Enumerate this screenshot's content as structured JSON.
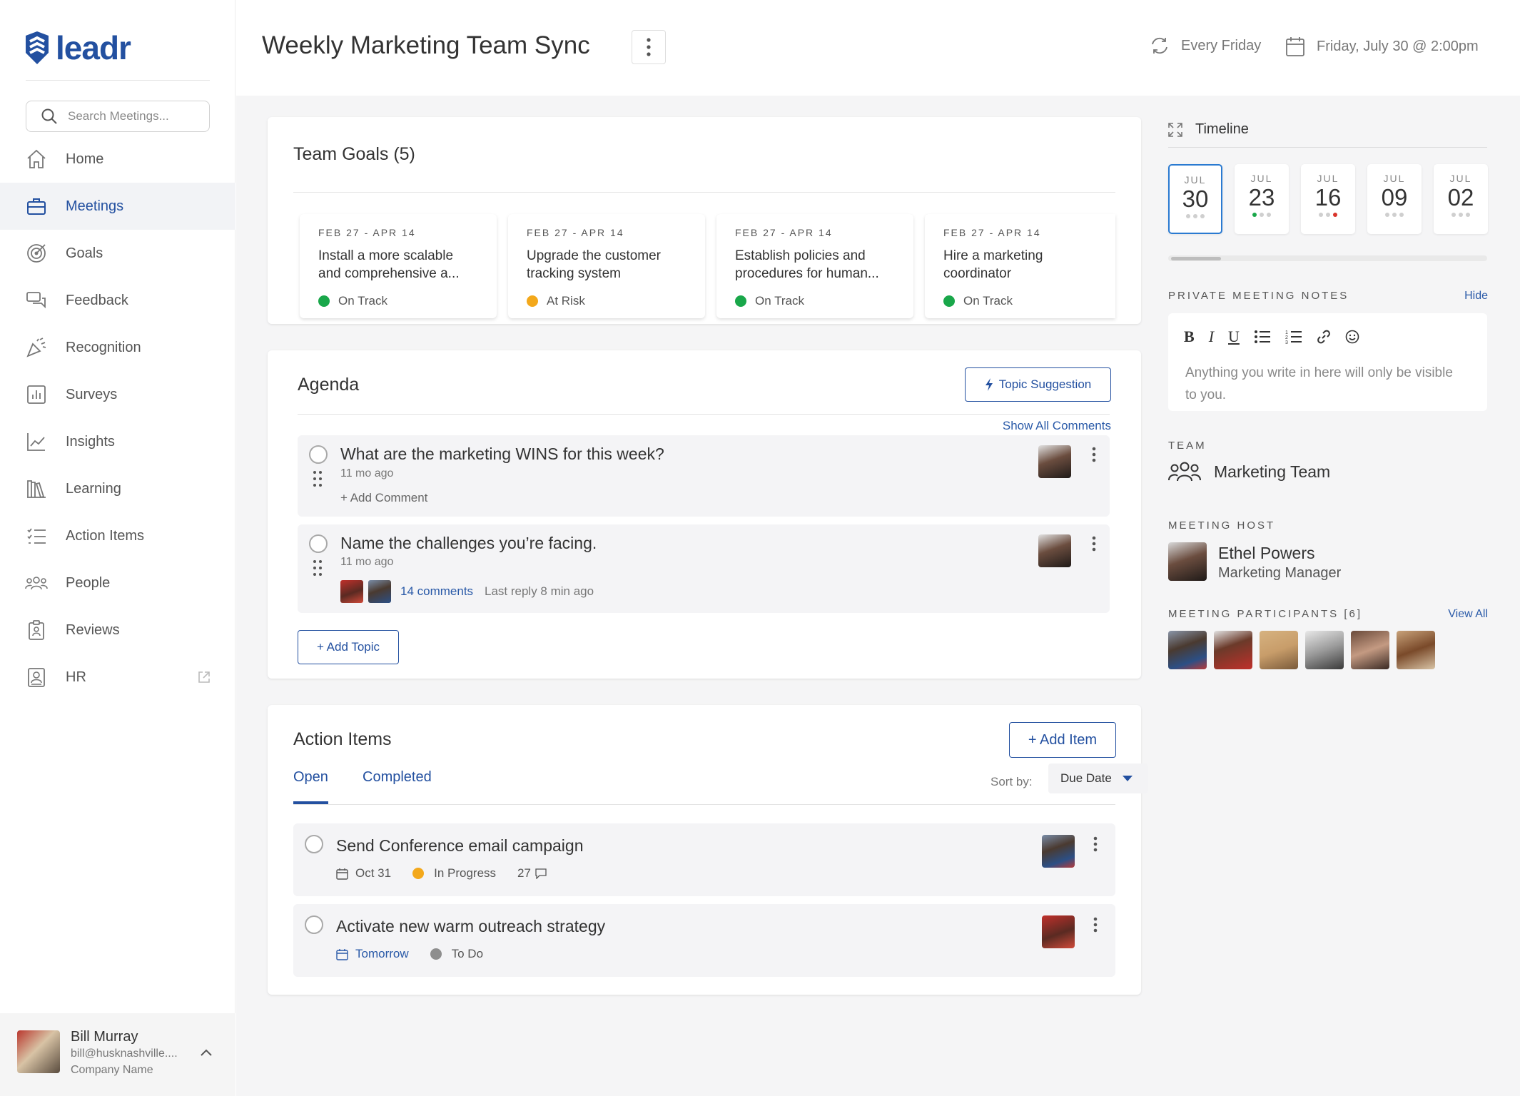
{
  "app": {
    "logo_text": "leadr",
    "brand_color": "#2350a0"
  },
  "sidebar": {
    "search_placeholder": "Search Meetings...",
    "items": [
      {
        "label": "Home",
        "icon": "home-icon"
      },
      {
        "label": "Meetings",
        "icon": "briefcase-icon",
        "active": true
      },
      {
        "label": "Goals",
        "icon": "target-icon"
      },
      {
        "label": "Feedback",
        "icon": "chat-bubbles-icon"
      },
      {
        "label": "Recognition",
        "icon": "party-popper-icon"
      },
      {
        "label": "Surveys",
        "icon": "bar-chart-icon"
      },
      {
        "label": "Insights",
        "icon": "line-chart-icon"
      },
      {
        "label": "Learning",
        "icon": "books-icon"
      },
      {
        "label": "Action Items",
        "icon": "checklist-icon"
      },
      {
        "label": "People",
        "icon": "people-icon"
      },
      {
        "label": "Reviews",
        "icon": "clipboard-icon"
      },
      {
        "label": "HR",
        "icon": "id-badge-icon"
      }
    ],
    "user": {
      "name": "Bill Murray",
      "email": "bill@husknashville....",
      "company": "Company Name"
    }
  },
  "header": {
    "title": "Weekly Marketing Team Sync",
    "recurrence": "Every Friday",
    "datetime": "Friday, July 30 @ 2:00pm"
  },
  "goals": {
    "title": "Team Goals (5)",
    "items": [
      {
        "date": "FEB 27 - APR 14",
        "title": "Install a more scalable and comprehensive a...",
        "status": "On Track",
        "status_color": "#19a74a"
      },
      {
        "date": "FEB 27 - APR 14",
        "title": "Upgrade the customer tracking system",
        "status": "At Risk",
        "status_color": "#f3a81b"
      },
      {
        "date": "FEB 27 - APR 14",
        "title": "Establish policies and procedures for human...",
        "status": "On Track",
        "status_color": "#19a74a"
      },
      {
        "date": "FEB 27 - APR 14",
        "title": "Hire a marketing coordinator",
        "status": "On Track",
        "status_color": "#19a74a"
      }
    ]
  },
  "agenda": {
    "title": "Agenda",
    "topic_suggestion_label": "Topic Suggestion",
    "show_all_comments": "Show All Comments",
    "topics": [
      {
        "title": "What are the marketing WINS for this week?",
        "age": "11 mo ago",
        "add_comment": "+ Add Comment"
      },
      {
        "title": "Name the challenges you’re facing.",
        "age": "11 mo ago",
        "comments": "14 comments",
        "last_reply": "Last reply 8 min ago"
      }
    ],
    "add_topic_label": "+ Add Topic"
  },
  "action_items": {
    "title": "Action Items",
    "add_label": "+ Add Item",
    "tabs": [
      {
        "label": "Open",
        "active": true
      },
      {
        "label": "Completed"
      }
    ],
    "sort_label": "Sort by:",
    "sort_value": "Due Date",
    "items": [
      {
        "title": "Send Conference email campaign",
        "due": "Oct 31",
        "status": "In Progress",
        "status_color": "#f3a81b",
        "comment_count": "27"
      },
      {
        "title": "Activate new warm outreach strategy",
        "due": "Tomorrow",
        "status": "To Do",
        "status_color": "#8e8e8e"
      }
    ]
  },
  "timeline": {
    "title": "Timeline",
    "days": [
      {
        "month": "JUL",
        "day": "30",
        "active": true
      },
      {
        "month": "JUL",
        "day": "23"
      },
      {
        "month": "JUL",
        "day": "16"
      },
      {
        "month": "JUL",
        "day": "09"
      },
      {
        "month": "JUL",
        "day": "02"
      }
    ]
  },
  "notes": {
    "label": "PRIVATE MEETING NOTES",
    "hide_label": "Hide",
    "placeholder": "Anything you write in here will only be visible to you."
  },
  "team": {
    "label": "TEAM",
    "name": "Marketing Team"
  },
  "host": {
    "label": "MEETING HOST",
    "name": "Ethel Powers",
    "title": "Marketing Manager"
  },
  "participants": {
    "label": "MEETING PARTICIPANTS [6]",
    "view_all": "View All"
  }
}
